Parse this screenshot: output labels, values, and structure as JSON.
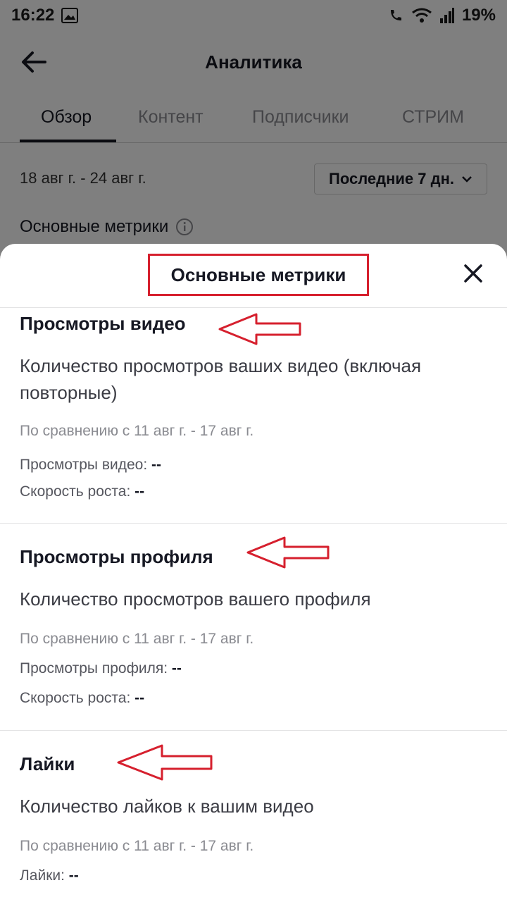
{
  "status_bar": {
    "time": "16:22",
    "battery": "19%"
  },
  "header": {
    "title": "Аналитика"
  },
  "tabs": [
    {
      "label": "Обзор",
      "active": true
    },
    {
      "label": "Контент"
    },
    {
      "label": "Подписчики"
    },
    {
      "label": "СТРИМ"
    }
  ],
  "date_range": "18 авг г. - 24 авг г.",
  "period_select": {
    "value": "Последние 7 дн."
  },
  "metrics_section_label": "Основные метрики",
  "sheet": {
    "title": "Основные метрики",
    "sections": [
      {
        "title": "Просмотры видео",
        "description": "Количество просмотров ваших видео (включая повторные)",
        "comparison": "По сравнению с 11 авг г. - 17 авг г.",
        "value_label": "Просмотры видео:",
        "value": "--",
        "growth_label": "Скорость роста:",
        "growth": "--"
      },
      {
        "title": "Просмотры профиля",
        "description": "Количество просмотров вашего профиля",
        "comparison": "По сравнению с 11 авг г. - 17 авг г.",
        "value_label": "Просмотры профиля:",
        "value": "--",
        "growth_label": "Скорость роста:",
        "growth": "--"
      },
      {
        "title": "Лайки",
        "description": "Количество лайков к вашим видео",
        "comparison": "По сравнению с 11 авг г. - 17 авг г.",
        "value_label": "Лайки:",
        "value": "--"
      }
    ]
  },
  "colors": {
    "annotation": "#d6202e",
    "text": "#161823",
    "muted": "#8a8b91"
  },
  "icons": [
    "image-icon",
    "wifi-call-icon",
    "wifi-icon",
    "signal-icon",
    "back-arrow-icon",
    "info-icon",
    "chevron-down-icon",
    "close-icon"
  ]
}
